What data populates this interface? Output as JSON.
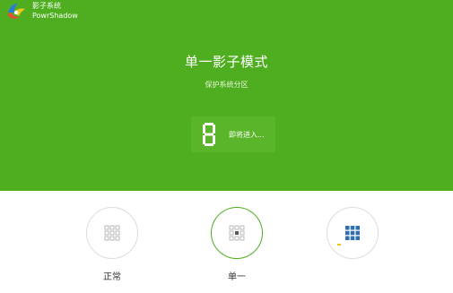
{
  "app": {
    "name_cn": "影子系统",
    "name_en": "PowrShadow"
  },
  "banner": {
    "title": "单一影子模式",
    "subtitle": "保护系统分区",
    "status_digit": "8",
    "status_text": "即将进入..."
  },
  "modes": [
    {
      "label": "正常",
      "icon": "grid-outline-icon",
      "active": false
    },
    {
      "label": "单一",
      "icon": "grid-center-icon",
      "active": true
    },
    {
      "label": "",
      "icon": "grid-filled-icon",
      "active": false
    }
  ],
  "colors": {
    "banner_green": "#4fae1f",
    "icon_gray": "#b8b8b8",
    "icon_dark": "#5a5a5a",
    "icon_blue": "#2d6fb0"
  }
}
